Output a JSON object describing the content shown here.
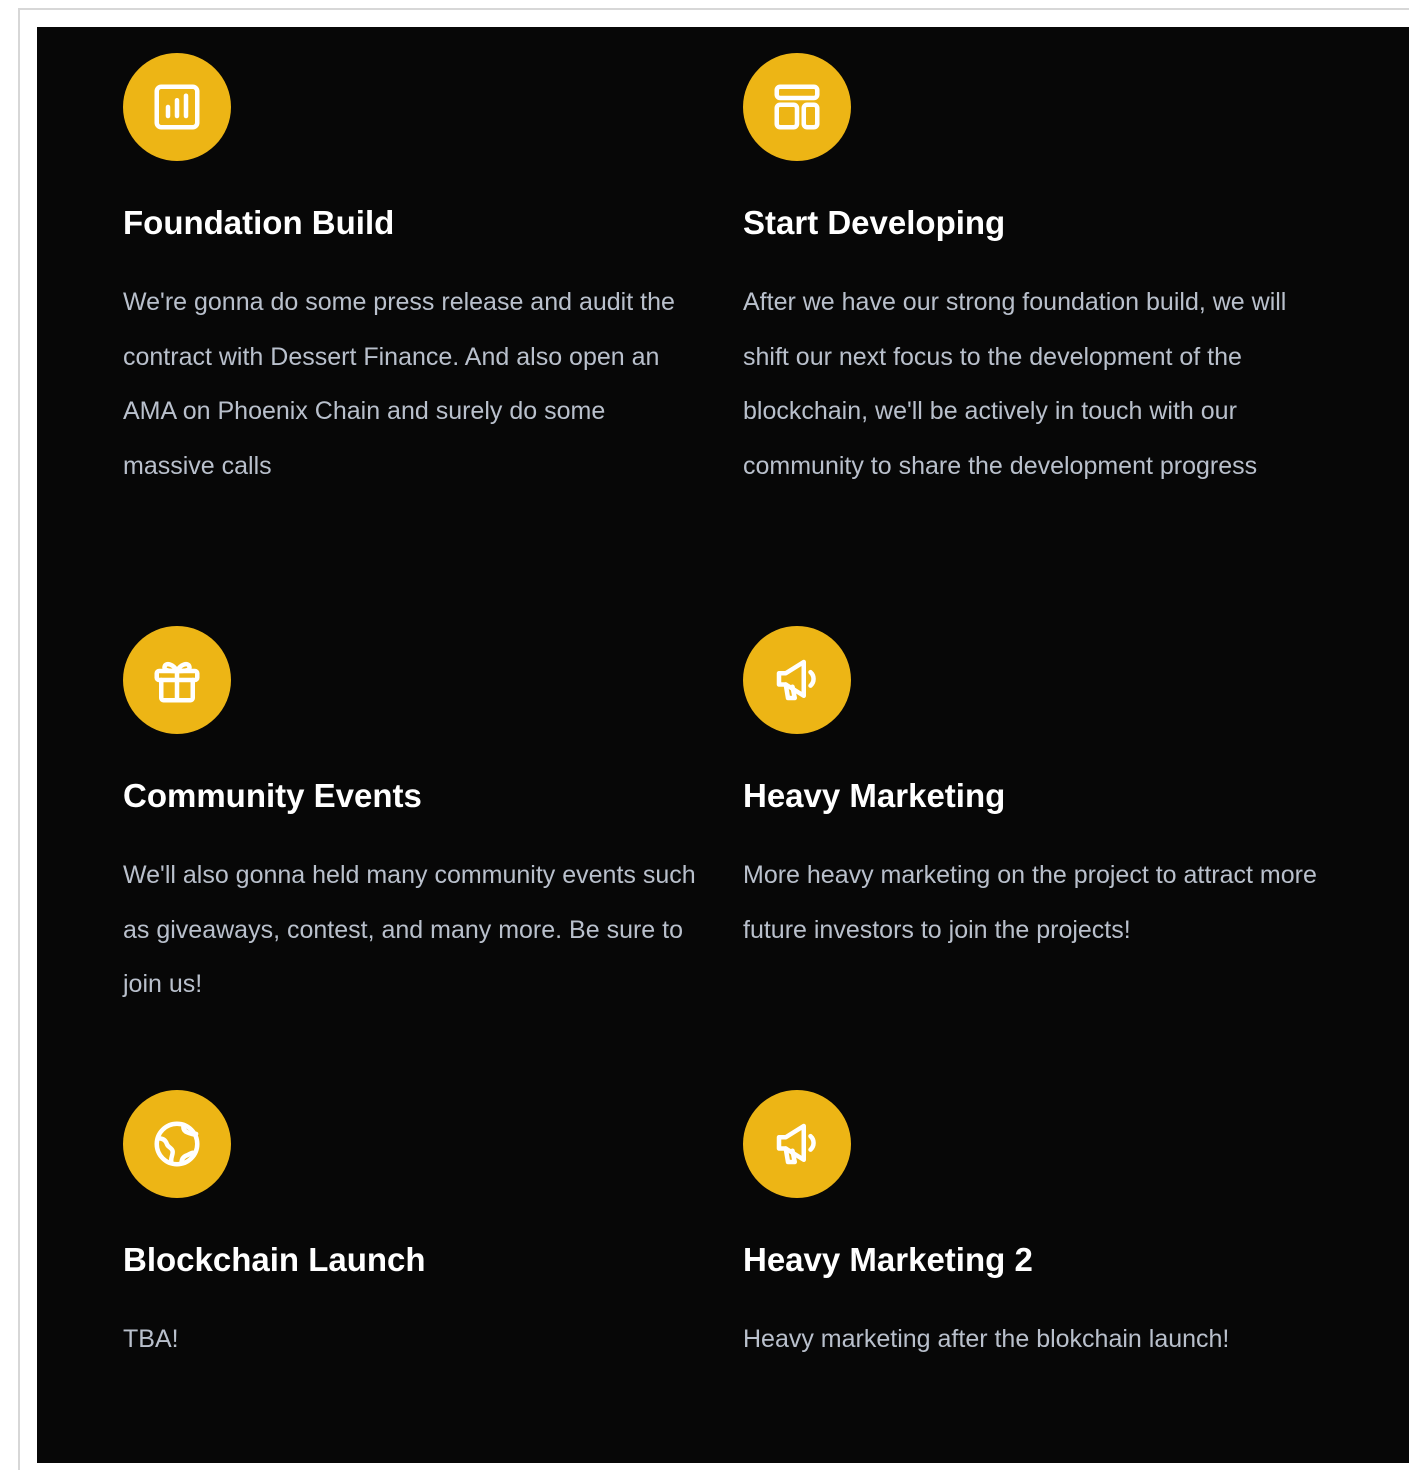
{
  "colors": {
    "panel_background": "#070707",
    "accent": "#edb515",
    "title": "#ffffff",
    "description": "#b9c0cc"
  },
  "cards": [
    {
      "icon": "bar-chart-icon",
      "title": "Foundation Build",
      "description": "We're gonna do some press release and audit the contract with Dessert Finance. And also open an AMA on Phoenix Chain and surely do some massive calls"
    },
    {
      "icon": "layout-icon",
      "title": "Start Developing",
      "description": "After we have our strong foundation build, we will shift our next focus to the development of the blockchain, we'll be actively in touch with our community to share the development progress"
    },
    {
      "icon": "gift-icon",
      "title": "Community Events",
      "description": "We'll also gonna held many community events such as giveaways, contest, and many more. Be sure to join us!"
    },
    {
      "icon": "megaphone-icon",
      "title": "Heavy Marketing",
      "description": "More heavy marketing on the project to attract more future investors to join the projects!"
    },
    {
      "icon": "globe-icon",
      "title": "Blockchain Launch",
      "description": "TBA!"
    },
    {
      "icon": "megaphone-icon",
      "title": "Heavy Marketing 2",
      "description": "Heavy marketing after the blokchain launch!"
    }
  ]
}
